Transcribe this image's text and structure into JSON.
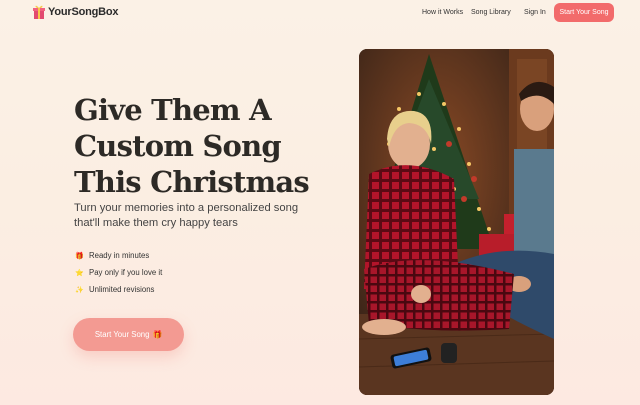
{
  "brand": {
    "name": "YourSongBox",
    "icon": "gift-icon",
    "accent": "#f26b6b"
  },
  "nav": {
    "how_it_works": "How it Works",
    "song_library": "Song Library",
    "sign_in": "Sign In",
    "cta": "Start Your Song"
  },
  "hero": {
    "title_lines": [
      "Give Them A",
      "Custom Song",
      "This Christmas"
    ],
    "subtitle": "Turn your memories into a personalized song that'll make them cry happy tears",
    "features": [
      {
        "icon": "gift-icon",
        "glyph": "🎁",
        "label": "Ready in minutes"
      },
      {
        "icon": "star-icon",
        "glyph": "⭐",
        "label": "Pay only if you love it"
      },
      {
        "icon": "sparkle-icon",
        "glyph": "✨",
        "label": "Unlimited revisions"
      }
    ],
    "cta": "Start Your Song",
    "cta_icon": "🎁",
    "image": "couple-christmas-tree-photo"
  }
}
